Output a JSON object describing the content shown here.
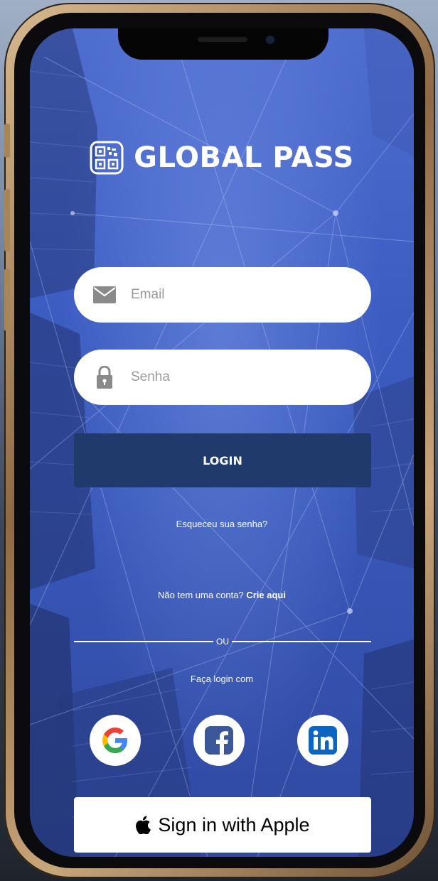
{
  "app": {
    "title": "GLOBAL PASS"
  },
  "form": {
    "email_placeholder": "Email",
    "password_placeholder": "Senha",
    "login_label": "LOGIN",
    "forgot_password": "Esqueceu sua senha?",
    "no_account_text": "Não tem uma conta?",
    "create_account_link": "Crie aqui"
  },
  "divider": {
    "label": "OU"
  },
  "social": {
    "prompt": "Faça login com",
    "providers": [
      {
        "name": "google",
        "icon": "google-icon"
      },
      {
        "name": "facebook",
        "icon": "facebook-icon"
      },
      {
        "name": "linkedin",
        "icon": "linkedin-icon"
      }
    ],
    "apple_label": "Sign in with Apple"
  },
  "colors": {
    "login_button": "#1f3a6b",
    "background_blue": "#3c5cc2",
    "facebook": "#3b5998",
    "linkedin": "#0a66c2"
  }
}
